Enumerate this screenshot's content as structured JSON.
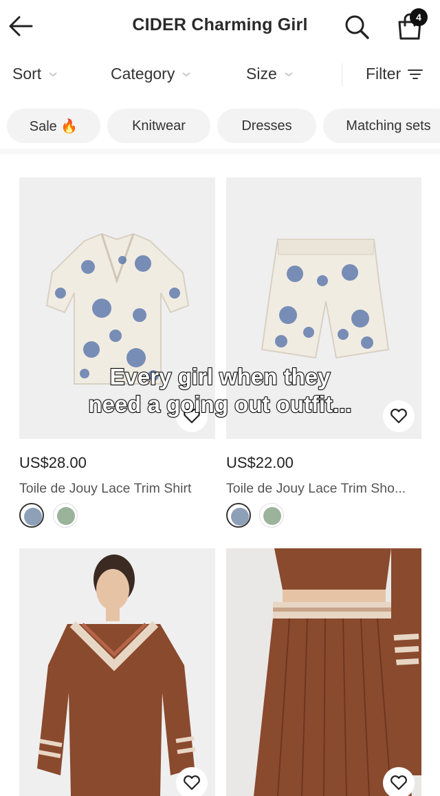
{
  "header": {
    "title": "CIDER Charming Girl",
    "cart_count": "4",
    "icons": [
      "back-arrow-icon",
      "search-icon",
      "cart-icon"
    ]
  },
  "sort_bar": {
    "sort": "Sort",
    "category": "Category",
    "size": "Size",
    "filter": "Filter"
  },
  "chips": [
    {
      "label": "Sale 🔥"
    },
    {
      "label": "Knitwear"
    },
    {
      "label": "Dresses"
    },
    {
      "label": "Matching sets"
    }
  ],
  "products": [
    {
      "price": "US$28.00",
      "name": "Toile de Jouy Lace Trim Shirt",
      "swatches": [
        "#8ea0b8",
        "#9bb39a"
      ]
    },
    {
      "price": "US$22.00",
      "name": "Toile de Jouy Lace Trim Sho...",
      "swatches": [
        "#8ea0b8",
        "#9bb39a"
      ]
    },
    {
      "price": "",
      "name": "",
      "swatches": []
    },
    {
      "price": "",
      "name": "",
      "swatches": []
    }
  ],
  "overlay_caption": {
    "line1": "Every girl when they",
    "line2": "need a going out outfit..."
  },
  "colors": {
    "brown_knit": "#8a4a2e",
    "cream_stripe": "#e8d6c4",
    "toile_blue": "#4f6ea8"
  }
}
